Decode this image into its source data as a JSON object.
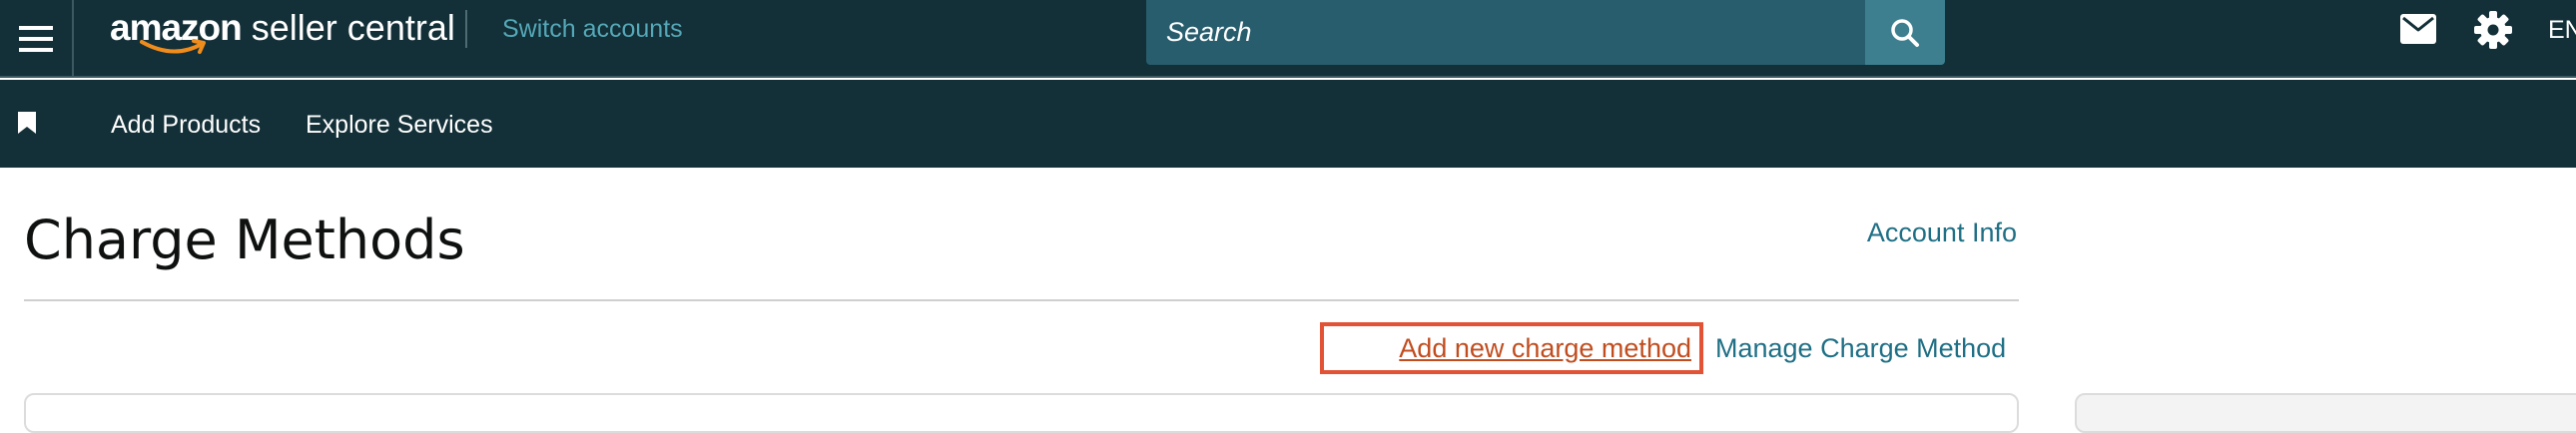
{
  "header": {
    "logo": {
      "brand": "amazon",
      "product": "seller central"
    },
    "switch_accounts": "Switch accounts",
    "search": {
      "placeholder": "Search"
    },
    "language": "EN",
    "icons": [
      "menu-icon",
      "search-icon",
      "mail-icon",
      "gear-icon"
    ]
  },
  "nav": {
    "items": [
      {
        "label": "Add Products"
      },
      {
        "label": "Explore Services"
      }
    ],
    "icons": [
      "bookmark-icon"
    ]
  },
  "main": {
    "title": "Charge Methods",
    "account_info": "Account Info",
    "actions": {
      "add_new": "Add new charge method",
      "manage": "Manage Charge Method"
    }
  },
  "colors": {
    "header_bg": "#132f37",
    "search_bg": "#285d6d",
    "search_button_bg": "#3d7f8f",
    "link": "#1f6f85",
    "switch_accounts": "#54a8b8",
    "highlight_border": "#e25234",
    "highlight_link": "#c14d1f"
  }
}
